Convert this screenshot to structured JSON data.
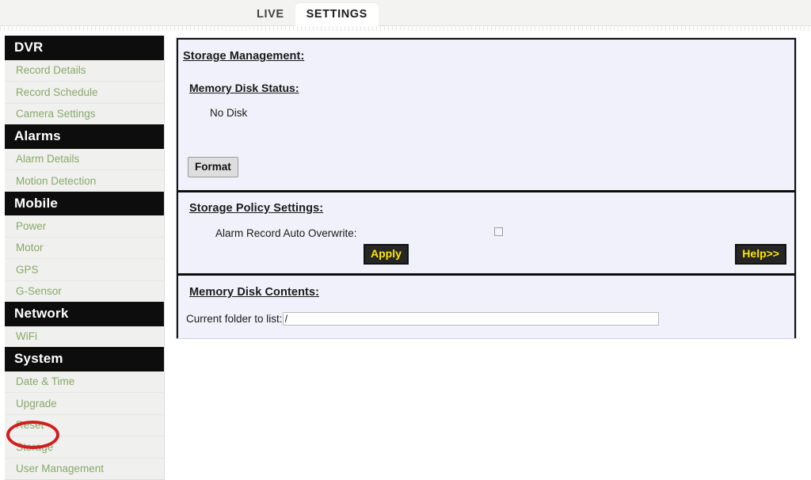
{
  "header": {
    "tabs": [
      {
        "label": "LIVE",
        "active": false
      },
      {
        "label": "SETTINGS",
        "active": true
      }
    ]
  },
  "sidebar": {
    "groups": [
      {
        "title": "DVR",
        "items": [
          "Record Details",
          "Record Schedule",
          "Camera Settings"
        ]
      },
      {
        "title": "Alarms",
        "items": [
          "Alarm Details",
          "Motion Detection"
        ]
      },
      {
        "title": "Mobile",
        "items": [
          "Power",
          "Motor",
          "GPS",
          "G-Sensor"
        ]
      },
      {
        "title": "Network",
        "items": [
          "WiFi"
        ]
      },
      {
        "title": "System",
        "items": [
          "Date & Time",
          "Upgrade",
          "Reset",
          "Storage",
          "User Management"
        ]
      }
    ]
  },
  "main": {
    "storage_management": {
      "heading": "Storage Management:",
      "status_heading": "Memory Disk Status:",
      "status_value": "No Disk",
      "format_button": "Format"
    },
    "storage_policy": {
      "heading": "Storage Policy Settings:",
      "auto_overwrite_label": "Alarm Record Auto Overwrite:",
      "auto_overwrite_checked": false,
      "apply_button": "Apply",
      "help_button": "Help>>"
    },
    "memory_disk_contents": {
      "heading": "Memory Disk Contents:",
      "folder_label": "Current folder to list:",
      "folder_value": "/",
      "folder_placeholder": ""
    }
  },
  "annotation": {
    "target": "Storage",
    "color": "#d01e1e"
  },
  "colors": {
    "nav_group_bg": "#0d0d0d",
    "nav_link": "#8aa86b",
    "panel_bg": "#f1f1fb",
    "button_dark_bg": "#262626",
    "button_dark_text": "#ffe600",
    "annotation": "#d01e1e"
  }
}
